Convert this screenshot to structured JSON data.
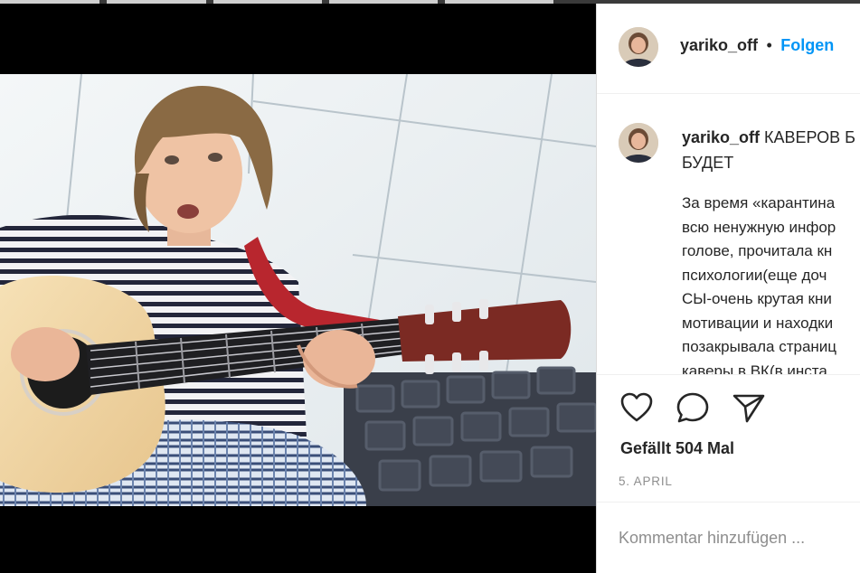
{
  "post": {
    "username": "yariko_off",
    "follow_label": "Folgen",
    "separator": "•",
    "caption_title": "КАВЕРОВ Б",
    "caption_title_line2": "БУДЕТ",
    "caption_lines": [
      "За время «карантина",
      "всю ненужную инфор",
      "голове, прочитала кн",
      "психологии(еще доч",
      "СЫ-очень крутая кни",
      "мотивации и находки",
      "позакрывала страниц",
      "каверы в ВК(в инста "
    ],
    "likes_text": "Gefällt 504 Mal",
    "date_text": "5. APRIL",
    "comment_placeholder": "Kommentar hinzufügen ..."
  },
  "icons": {
    "like": "heart-icon",
    "comment": "comment-bubble-icon",
    "share": "paper-plane-icon"
  },
  "colors": {
    "accent": "#0095f6",
    "text": "#262626",
    "muted": "#8e8e8e",
    "divider": "#efefef"
  }
}
